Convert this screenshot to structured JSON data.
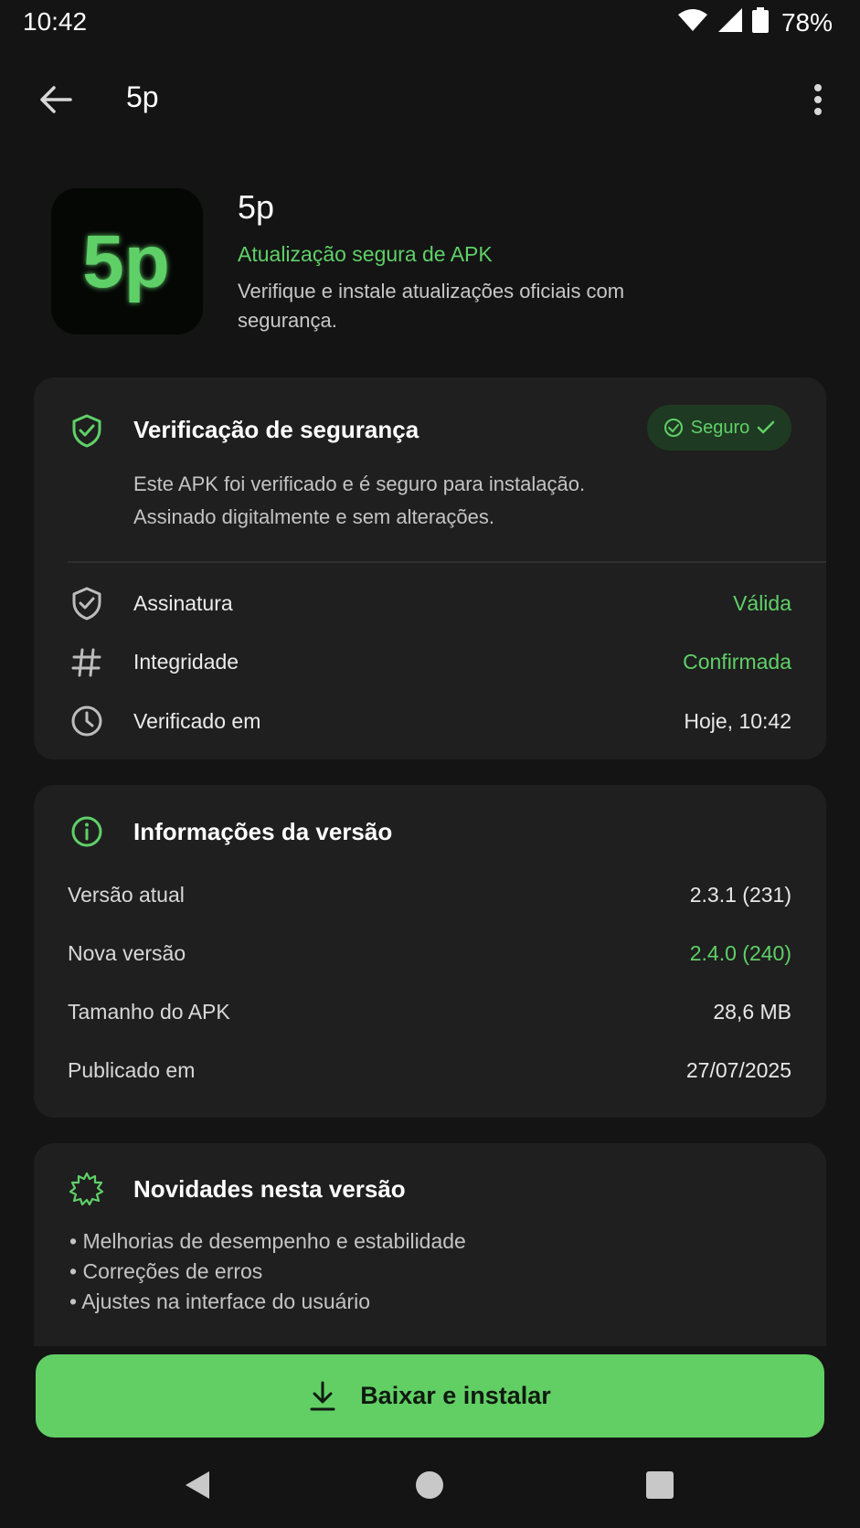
{
  "status_bar": {
    "time": "10:42",
    "battery": "78%"
  },
  "app_bar": {
    "title": "5p"
  },
  "header": {
    "icon_text": "5p",
    "name": "5p",
    "subtitle": "Atualização segura de APK",
    "description": "Verifique e instale atualizações oficiais com segurança."
  },
  "security": {
    "title": "Verificação de segurança",
    "badge": "Seguro",
    "desc_line1": "Este APK foi verificado e é seguro para instalação.",
    "desc_line2": "Assinado digitalmente e sem alterações.",
    "rows": [
      {
        "label": "Assinatura",
        "value": "Válida",
        "icon": "shield-check-icon"
      },
      {
        "label": "Integridade",
        "value": "Confirmada",
        "icon": "hash-icon"
      },
      {
        "label": "Verificado em",
        "value": "Hoje, 10:42",
        "icon": "clock-icon"
      }
    ]
  },
  "version": {
    "title": "Informações da versão",
    "rows": [
      {
        "label": "Versão atual",
        "value": "2.3.1 (231)"
      },
      {
        "label": "Nova versão",
        "value": "2.4.0 (240)"
      },
      {
        "label": "Tamanho do APK",
        "value": "28,6 MB"
      },
      {
        "label": "Publicado em",
        "value": "27/07/2025"
      }
    ]
  },
  "news": {
    "title": "Novidades nesta versão",
    "items": [
      "Melhorias de desempenho e estabilidade",
      "Correções de erros",
      "Ajustes na interface do usuário"
    ]
  },
  "install_button": {
    "label": "Baixar e instalar"
  },
  "colors": {
    "accent": "#5fd068",
    "background": "#141414",
    "card": "#1f1f1f",
    "button": "#62cf65"
  }
}
